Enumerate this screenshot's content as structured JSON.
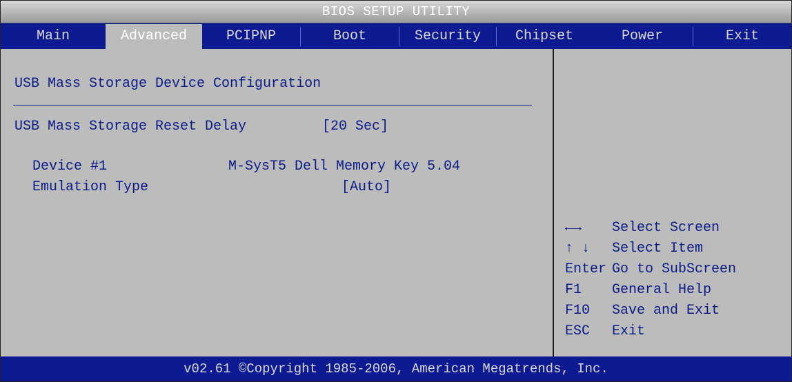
{
  "title": "BIOS SETUP UTILITY",
  "tabs": [
    "Main",
    "Advanced",
    "PCIPNP",
    "Boot",
    "Security",
    "Chipset",
    "Power",
    "Exit"
  ],
  "active_tab": "Advanced",
  "section": {
    "heading": "USB Mass Storage Device Configuration",
    "reset_delay_label": "USB Mass Storage Reset Delay",
    "reset_delay_value": "[20 Sec]",
    "device_label": "Device #1",
    "device_value": "M-SysT5 Dell Memory Key 5.04",
    "emulation_label": "Emulation Type",
    "emulation_value": "[Auto]"
  },
  "help": [
    {
      "key": "←→",
      "desc": "Select Screen"
    },
    {
      "key": "↑ ↓",
      "desc": "Select Item"
    },
    {
      "key": "Enter",
      "desc": "Go to SubScreen"
    },
    {
      "key": "F1",
      "desc": "General Help"
    },
    {
      "key": "F10",
      "desc": "Save and Exit"
    },
    {
      "key": "ESC",
      "desc": "Exit"
    }
  ],
  "footer": "v02.61 ©Copyright 1985-2006, American Megatrends, Inc.",
  "colors": {
    "background": "#bcbcbc",
    "menu_bar": "#0d1a91",
    "text": "#0b1b86",
    "menu_text": "#d9d9d9"
  }
}
